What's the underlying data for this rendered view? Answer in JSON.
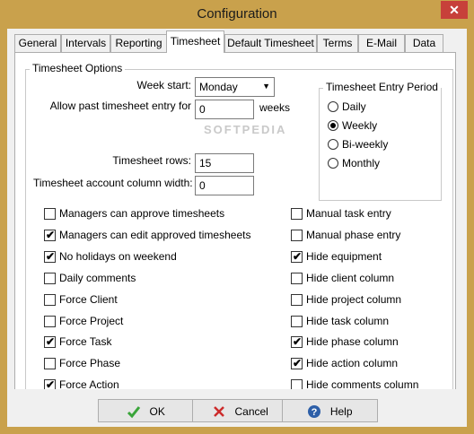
{
  "window": {
    "title": "Configuration",
    "close_label": "✕"
  },
  "tabs": [
    "General",
    "Intervals",
    "Reporting",
    "Timesheet",
    "Default Timesheet",
    "Terms",
    "E-Mail",
    "Data"
  ],
  "active_tab": "Timesheet",
  "timesheet_options": {
    "group_title": "Timesheet Options",
    "week_start_label": "Week start:",
    "week_start_value": "Monday",
    "allow_past_label": "Allow past timesheet entry for",
    "allow_past_value": "0",
    "weeks_label": "weeks",
    "rows_label": "Timesheet rows:",
    "rows_value": "15",
    "account_width_label": "Timesheet account column width:",
    "account_width_value": "0"
  },
  "entry_period": {
    "group_title": "Timesheet Entry Period",
    "options": [
      "Daily",
      "Weekly",
      "Bi-weekly",
      "Monthly"
    ],
    "selected": "Weekly"
  },
  "left_checks": [
    {
      "label": "Managers can approve timesheets",
      "checked": false
    },
    {
      "label": "Managers can edit approved timesheets",
      "checked": true
    },
    {
      "label": "No holidays on weekend",
      "checked": true
    },
    {
      "label": "Daily comments",
      "checked": false
    },
    {
      "label": "Force Client",
      "checked": false
    },
    {
      "label": "Force Project",
      "checked": false
    },
    {
      "label": "Force Task",
      "checked": true
    },
    {
      "label": "Force Phase",
      "checked": false
    },
    {
      "label": "Force Action",
      "checked": true
    }
  ],
  "right_checks": [
    {
      "label": "Manual task entry",
      "checked": false
    },
    {
      "label": "Manual phase entry",
      "checked": false
    },
    {
      "label": "Hide equipment",
      "checked": true
    },
    {
      "label": "Hide client column",
      "checked": false
    },
    {
      "label": "Hide project column",
      "checked": false
    },
    {
      "label": "Hide task column",
      "checked": false
    },
    {
      "label": "Hide phase column",
      "checked": true
    },
    {
      "label": "Hide action column",
      "checked": true
    },
    {
      "label": "Hide comments column",
      "checked": false
    }
  ],
  "watermark": "SOFTPEDIA",
  "buttons": {
    "ok": "OK",
    "cancel": "Cancel",
    "help": "Help"
  },
  "colors": {
    "frame": "#c9a14c",
    "close": "#c7403a",
    "ok_icon": "#3aa53a",
    "cancel_icon": "#cc2b2b",
    "help_icon": "#2d5fa8"
  }
}
